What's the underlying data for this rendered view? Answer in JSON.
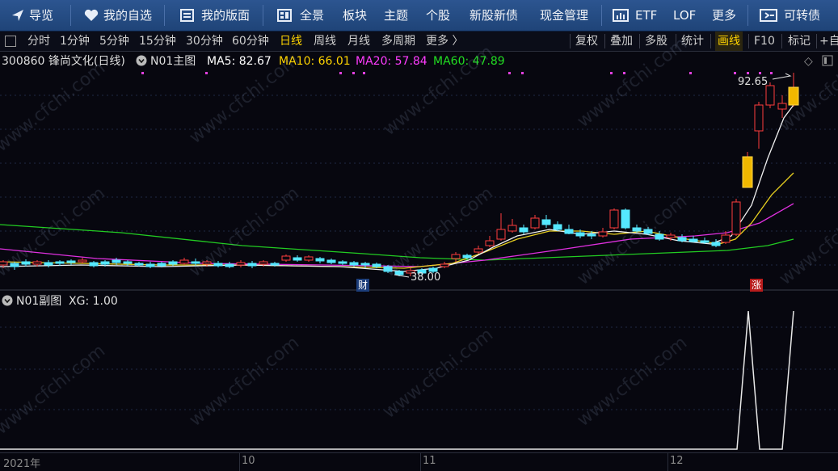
{
  "nav": {
    "items": [
      {
        "icon": "arrow-icon",
        "label": "导览"
      },
      {
        "icon": "heart-icon",
        "label": "我的自选"
      },
      {
        "icon": "layout-icon",
        "label": "我的版面"
      },
      {
        "icon": "grid-icon",
        "label": "全景"
      },
      {
        "icon": "",
        "label": "板块"
      },
      {
        "icon": "",
        "label": "主题"
      },
      {
        "icon": "",
        "label": "个股"
      },
      {
        "icon": "",
        "label": "新股新债"
      },
      {
        "icon": "",
        "label": "现金管理"
      },
      {
        "icon": "chart-icon",
        "label": "ETF"
      },
      {
        "icon": "",
        "label": "LOF"
      },
      {
        "icon": "",
        "label": "更多"
      },
      {
        "icon": "bond-icon",
        "label": "可转债"
      }
    ]
  },
  "toolbar": {
    "periods": [
      "分时",
      "1分钟",
      "5分钟",
      "15分钟",
      "30分钟",
      "60分钟",
      "日线",
      "周线",
      "月线",
      "多周期",
      "更多 〉"
    ],
    "active_period": "日线",
    "right": [
      "复权",
      "叠加",
      "多股",
      "统计",
      "画线",
      "F10",
      "标记",
      "+自"
    ],
    "highlight_right": "画线"
  },
  "main_info": {
    "code_name": "300860 锋尚文化(日线)",
    "indicator": "N01主图",
    "ma5": "MA5: 82.67",
    "ma10": "MA10: 66.01",
    "ma20": "MA20: 57.84",
    "ma60": "MA60: 47.89",
    "colors": {
      "ma5": "#ffffff",
      "ma10": "#ffd400",
      "ma20": "#ff3cff",
      "ma60": "#22dd22"
    }
  },
  "annotations": {
    "high_price": "92.65",
    "low_price": "38.00",
    "tag_cai": "财",
    "tag_zhang": "涨"
  },
  "sub_info": {
    "indicator": "N01副图",
    "xg": "XG: 1.00"
  },
  "xaxis": [
    "2021年",
    "10",
    "11",
    "12"
  ],
  "watermark": "www.cfchi.com",
  "chart_data": {
    "type": "candlestick",
    "ticker": "300860",
    "name": "锋尚文化",
    "period": "日线",
    "high_label": 92.65,
    "low_label": 38.0,
    "ma_latest": {
      "MA5": 82.67,
      "MA10": 66.01,
      "MA20": 57.84,
      "MA60": 47.89
    },
    "sub_indicator": {
      "name": "N01副图",
      "XG": 1.0
    }
  }
}
